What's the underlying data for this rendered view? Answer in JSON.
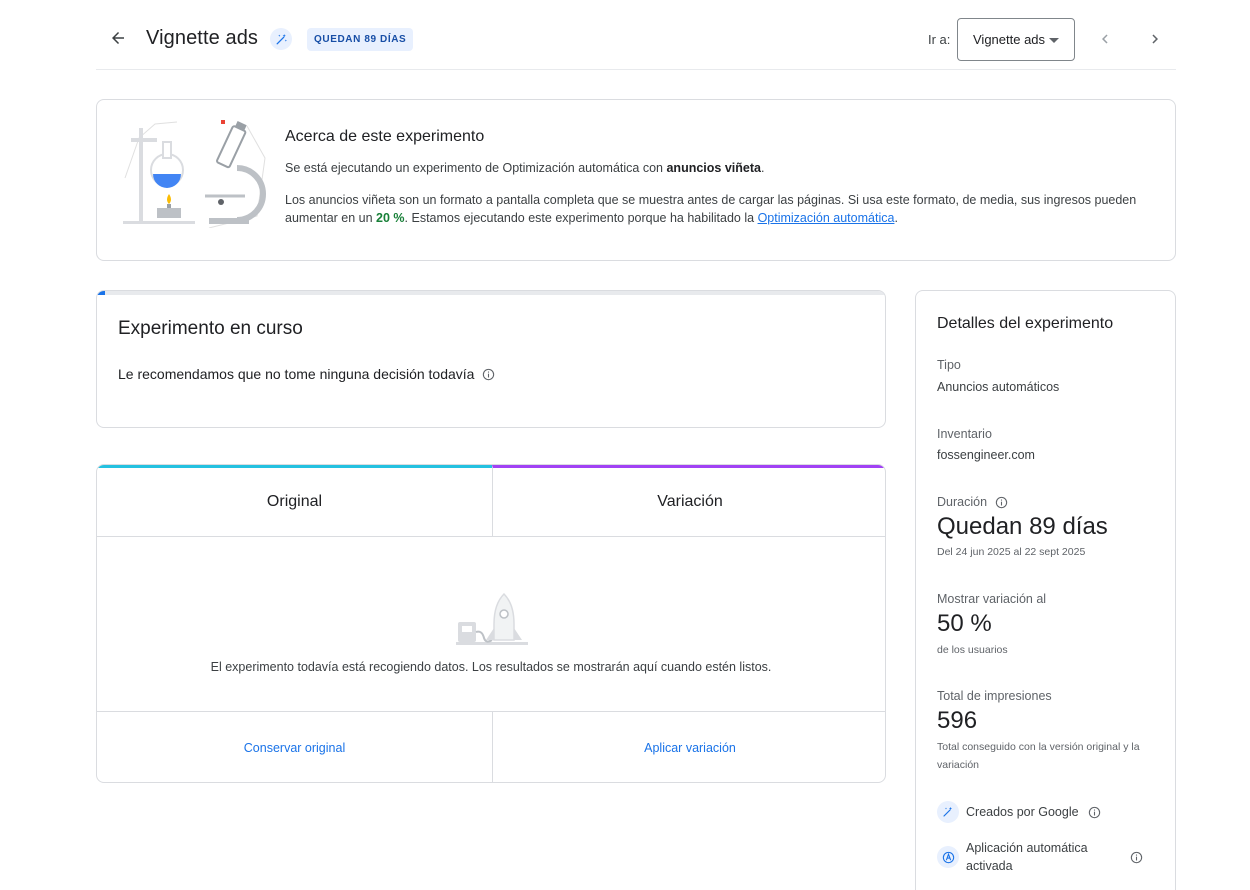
{
  "header": {
    "title": "Vignette ads",
    "days_chip": "QUEDAN 89 DÍAS",
    "goto_label": "Ir a:",
    "goto_value": "Vignette ads",
    "icons": {
      "back": "arrow-back-icon",
      "magic": "magic-wand-icon",
      "prev": "chevron-left-icon",
      "next": "chevron-right-icon"
    }
  },
  "about": {
    "title": "Acerca de este experimento",
    "line1_prefix": "Se está ejecutando un experimento de Optimización automática con ",
    "line1_bold": "anuncios viñeta",
    "line1_suffix": ".",
    "para_part1": "Los anuncios viñeta son un formato a pantalla completa que se muestra antes de cargar las páginas. Si usa este formato, de media, sus ingresos pueden aumentar en un ",
    "para_pct": "20 %",
    "para_part2": ". Estamos ejecutando este experimento porque ha habilitado la ",
    "para_link": "Optimización automática",
    "para_end": "."
  },
  "status": {
    "title": "Experimento en curso",
    "subtitle": "Le recomendamos que no tome ninguna decisión todavía",
    "progress_fraction": 0.01
  },
  "comparison": {
    "original_label": "Original",
    "variation_label": "Variación",
    "collecting_text": "El experimento todavía está recogiendo datos. Los resultados se mostrarán aquí cuando estén listos.",
    "keep_label": "Conservar original",
    "apply_label": "Aplicar variación"
  },
  "details": {
    "title": "Detalles del experimento",
    "type_label": "Tipo",
    "type_value": "Anuncios automáticos",
    "inventory_label": "Inventario",
    "inventory_value": "fossengineer.com",
    "duration_label": "Duración",
    "duration_value": "Quedan 89 días",
    "duration_range": "Del 24 jun 2025 al 22 sept 2025",
    "show_label": "Mostrar variación al",
    "show_value": "50 %",
    "show_sub": "de los usuarios",
    "impressions_label": "Total de impresiones",
    "impressions_value": "596",
    "impressions_sub": "Total conseguido con la versión original y la variación",
    "feature1": "Creados por Google",
    "feature2": "Aplicación automática activada"
  },
  "colors": {
    "accent": "#1a73e8",
    "original_bar": "#24c1e0",
    "variation_bar": "#a142f4",
    "positive": "#188038"
  }
}
